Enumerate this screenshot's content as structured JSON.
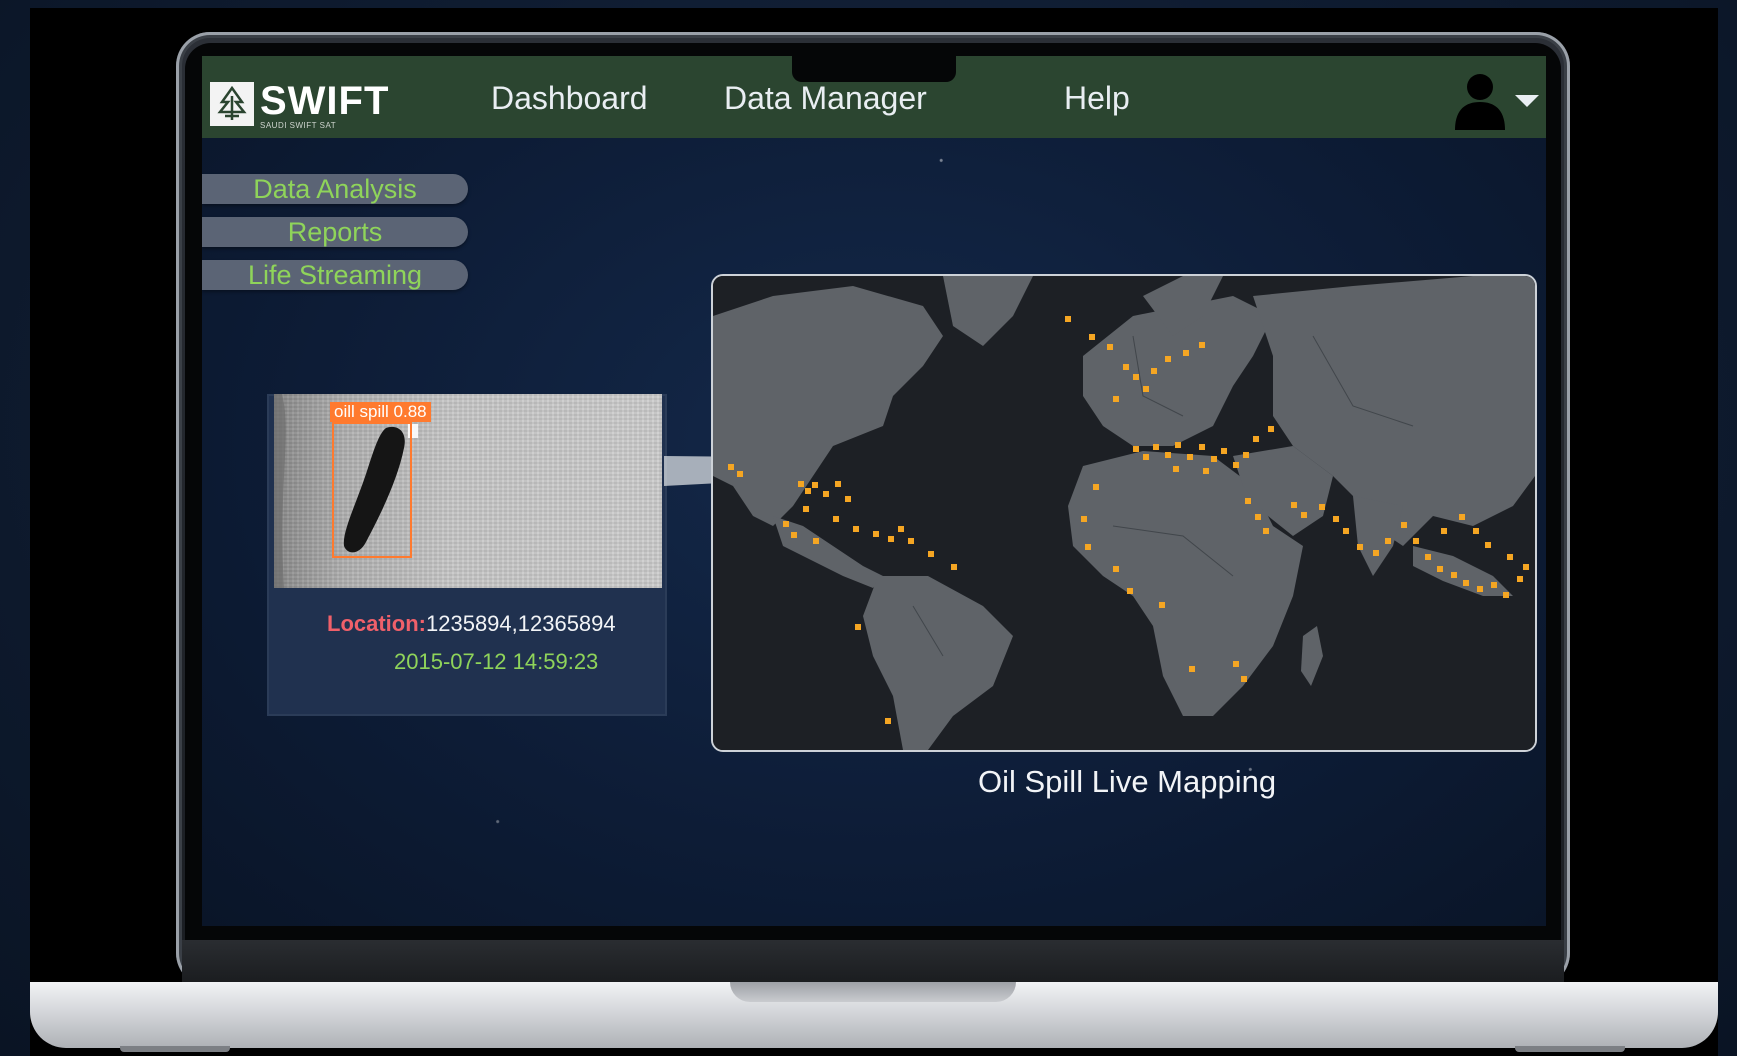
{
  "app": {
    "logo_name": "SWIFT",
    "logo_tagline": "SAUDI SWIFT SAT"
  },
  "nav": {
    "items": [
      {
        "label": "Dashboard"
      },
      {
        "label": "Data Manager"
      },
      {
        "label": "Help"
      }
    ]
  },
  "sidebar": {
    "items": [
      {
        "label": "Data Analysis"
      },
      {
        "label": "Reports"
      },
      {
        "label": "Life Streaming"
      }
    ]
  },
  "detection": {
    "label": "oill  spill  0.88",
    "location_key": "Location:",
    "location_value": "1235894,12365894",
    "timestamp": "2015-07-12 14:59:23"
  },
  "map": {
    "caption": "Oil Spill Live Mapping"
  },
  "colors": {
    "nav_bg": "#2b4530",
    "menu_text": "#8fd45a",
    "spill_marker": "#f5a623",
    "detection_box": "#ff7a2e",
    "location_key": "#f0606a"
  },
  "icons": {
    "logo": "tree-logo-icon",
    "user": "user-icon",
    "dropdown": "caret-down-icon"
  }
}
